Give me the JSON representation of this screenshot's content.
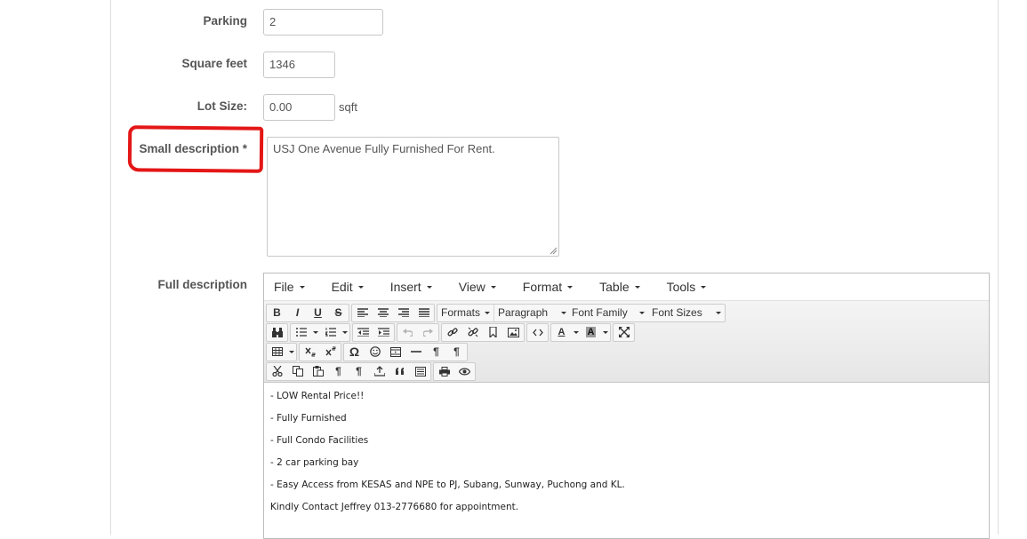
{
  "form": {
    "parking": {
      "label": "Parking",
      "value": "2"
    },
    "square_feet": {
      "label": "Square feet",
      "value": "1346"
    },
    "lot_size": {
      "label": "Lot Size:",
      "value": "0.00",
      "unit": "sqft"
    },
    "small_description": {
      "label": "Small description *",
      "value": "USJ One Avenue Fully Furnished For Rent."
    },
    "full_description": {
      "label": "Full description"
    }
  },
  "editor": {
    "menu": [
      "File",
      "Edit",
      "Insert",
      "View",
      "Format",
      "Table",
      "Tools"
    ],
    "toolbar": {
      "bold": "B",
      "italic": "I",
      "underline": "U",
      "strikethrough": "S",
      "formats": "Formats",
      "paragraph": "Paragraph",
      "font_family": "Font Family",
      "font_sizes": "Font Sizes",
      "text_color_letter": "A",
      "bg_color_letter": "A",
      "omega": "Ω",
      "pilcrow": "¶"
    },
    "content": [
      "- LOW Rental Price!!",
      "- Fully Furnished",
      "- Full Condo Facilities",
      "- 2 car parking bay",
      "- Easy Access from KESAS and NPE to PJ, Subang, Sunway, Puchong and KL.",
      "Kindly Contact Jeffrey 013-2776680 for appointment."
    ]
  },
  "colors": {
    "highlight": "#e41616",
    "label": "#555555",
    "border": "#c8c8c8"
  }
}
